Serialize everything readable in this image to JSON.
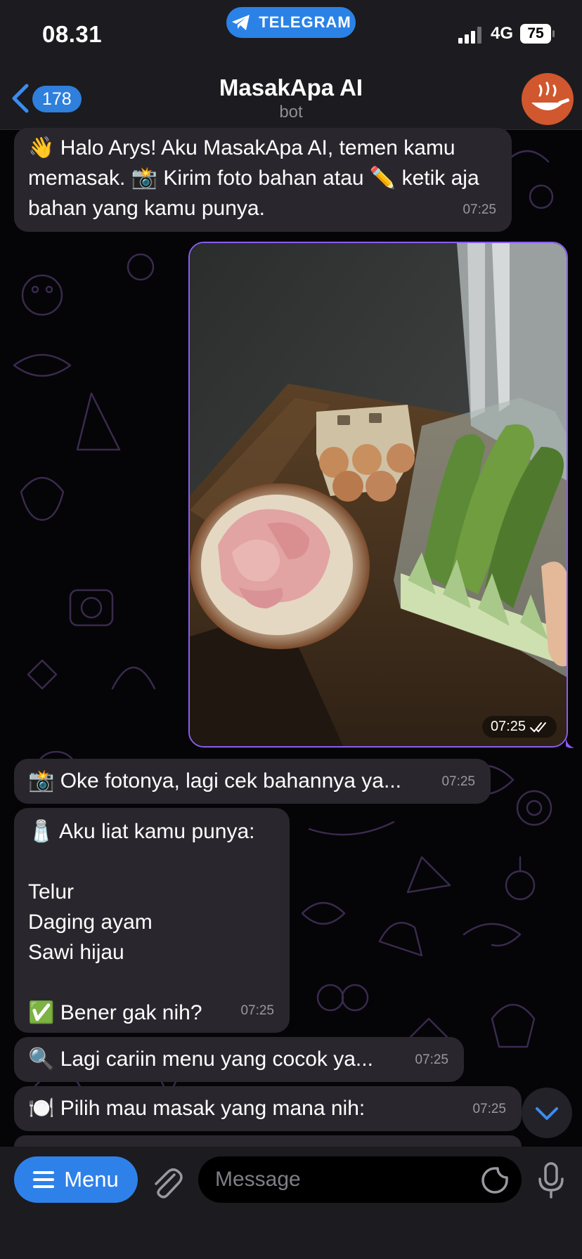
{
  "status_bar": {
    "time": "08.31",
    "app_pill": "TELEGRAM",
    "network": "4G",
    "battery": "75"
  },
  "header": {
    "back_count": "178",
    "title": "MasakApa AI",
    "subtitle": "bot"
  },
  "messages": {
    "welcome": {
      "text": "👋 Halo Arys! Aku MasakApa AI, temen kamu memasak. 📸 Kirim foto bahan atau ✏️ ketik aja bahan yang kamu punya.",
      "time": "07:25"
    },
    "photo": {
      "time": "07:25",
      "status_icon": "double-check-icon"
    },
    "checking": {
      "text": "📸 Oke fotonya, lagi cek bahannya ya...",
      "time": "07:25"
    },
    "ingredients": {
      "text": "🧂 Aku liat kamu punya:\n\nTelur\nDaging ayam\nSawi hijau\n\n✅ Bener gak nih?",
      "time": "07:25"
    },
    "searching": {
      "text": "🔍 Lagi cariin menu yang cocok ya...",
      "time": "07:25"
    },
    "choose": {
      "text": "🍽️ Pilih mau masak yang mana nih:",
      "time": "07:25"
    }
  },
  "input": {
    "menu_label": "Menu",
    "placeholder": "Message"
  },
  "colors": {
    "accent": "#2f81ea",
    "incoming_bubble": "#29272d",
    "outgoing_border": "#8a5df0",
    "background": "#050407"
  }
}
